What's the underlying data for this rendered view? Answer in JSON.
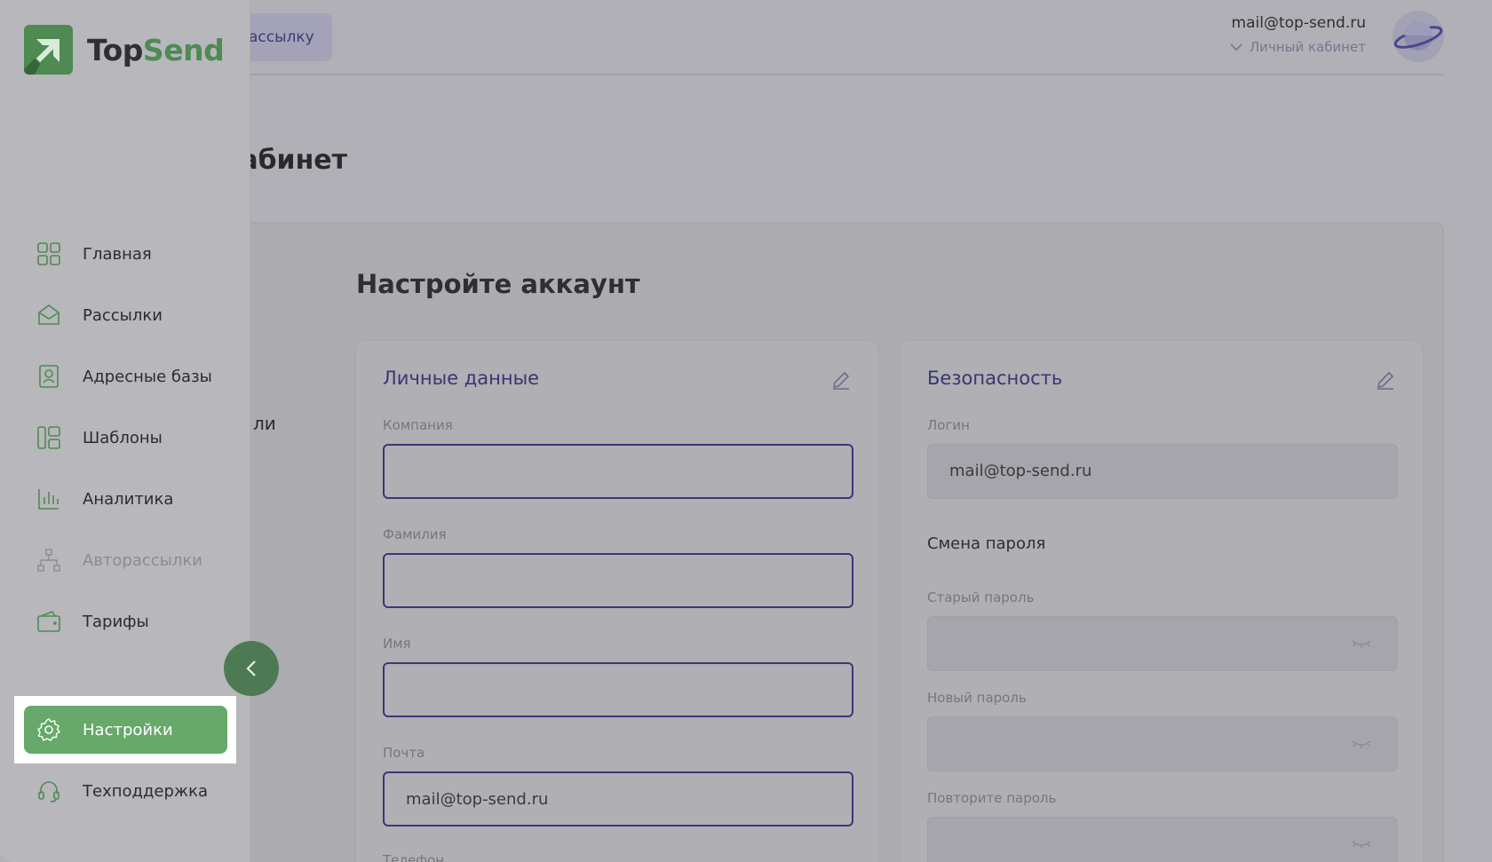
{
  "header": {
    "create_button_fragment": "ассылку",
    "user_email": "mail@top-send.ru",
    "account_link": "Личный кабинет"
  },
  "page": {
    "title_fragment": "кабинет",
    "tab_fragment": "ли",
    "section_title": "Настройте аккаунт"
  },
  "personal": {
    "title": "Личные данные",
    "fields": {
      "company": {
        "label": "Компания",
        "value": ""
      },
      "last_name": {
        "label": "Фамилия",
        "value": ""
      },
      "first_name": {
        "label": "Имя",
        "value": ""
      },
      "email": {
        "label": "Почта",
        "value": "mail@top-send.ru"
      },
      "phone": {
        "label": "Телефон"
      }
    }
  },
  "security": {
    "title": "Безопасность",
    "login_label": "Логин",
    "login_value": "mail@top-send.ru",
    "password_change_title": "Смена пароля",
    "old_password_label": "Старый пароль",
    "new_password_label": "Новый пароль",
    "repeat_password_label": "Повторите пароль"
  },
  "sidebar": {
    "logo_top": "Top",
    "logo_send": "Send",
    "items": [
      {
        "label": "Главная",
        "icon": "dashboard-icon"
      },
      {
        "label": "Рассылки",
        "icon": "mail-icon"
      },
      {
        "label": "Адресные базы",
        "icon": "contacts-icon"
      },
      {
        "label": "Шаблоны",
        "icon": "templates-icon"
      },
      {
        "label": "Аналитика",
        "icon": "analytics-icon"
      },
      {
        "label": "Авторассылки",
        "icon": "automation-icon"
      },
      {
        "label": "Тарифы",
        "icon": "wallet-icon"
      },
      {
        "label": "Настройки",
        "icon": "gear-icon"
      },
      {
        "label": "Техподдержка",
        "icon": "headset-icon"
      }
    ]
  },
  "colors": {
    "brand_green": "#66a96a",
    "accent_indigo": "#3b3778",
    "highlight": "#ffffff"
  }
}
